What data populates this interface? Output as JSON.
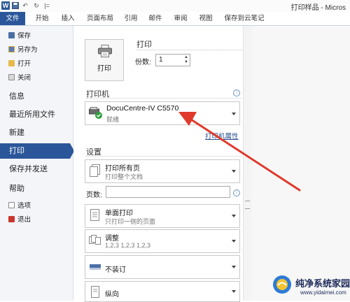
{
  "titlebar": {
    "word_icon": "W",
    "title": "打印样品 - Micros",
    "icons": [
      "word-icon",
      "save-icon",
      "undo-icon",
      "redo-icon",
      "customize-icon"
    ]
  },
  "ribbon": {
    "tabs": [
      "文件",
      "开始",
      "插入",
      "页面布局",
      "引用",
      "邮件",
      "审阅",
      "视图",
      "保存到云笔记"
    ],
    "active_color": "#2b579a"
  },
  "nav": {
    "save": "保存",
    "save_as": "另存为",
    "open": "打开",
    "close": "关闭",
    "info": "信息",
    "recent": "最近所用文件",
    "new": "新建",
    "print": "打印",
    "share": "保存并发送",
    "help": "帮助",
    "options": "选项",
    "exit": "退出"
  },
  "print": {
    "button_label": "打印",
    "heading": "打印",
    "copies_label": "份数:",
    "copies_value": "1"
  },
  "printer": {
    "section": "打印机",
    "name": "DocuCentre-IV C5570",
    "status": "就绪",
    "properties_link": "打印机属性"
  },
  "settings": {
    "section": "设置",
    "print_range_main": "打印所有页",
    "print_range_sub": "打印整个文档",
    "pages_label": "页数:",
    "pages_value": "",
    "sides_main": "单面打印",
    "sides_sub": "只打印一侧的页面",
    "collate_main": "调整",
    "collate_sub": "1,2,3    1,2,3    1,2,3",
    "staple_main": "不装订",
    "orientation_main": "纵向"
  },
  "watermark": {
    "title": "纯净系统家园",
    "url": "www.yidaimei.com"
  },
  "colors": {
    "accent": "#2b579a",
    "annotation": "#e0392b"
  }
}
